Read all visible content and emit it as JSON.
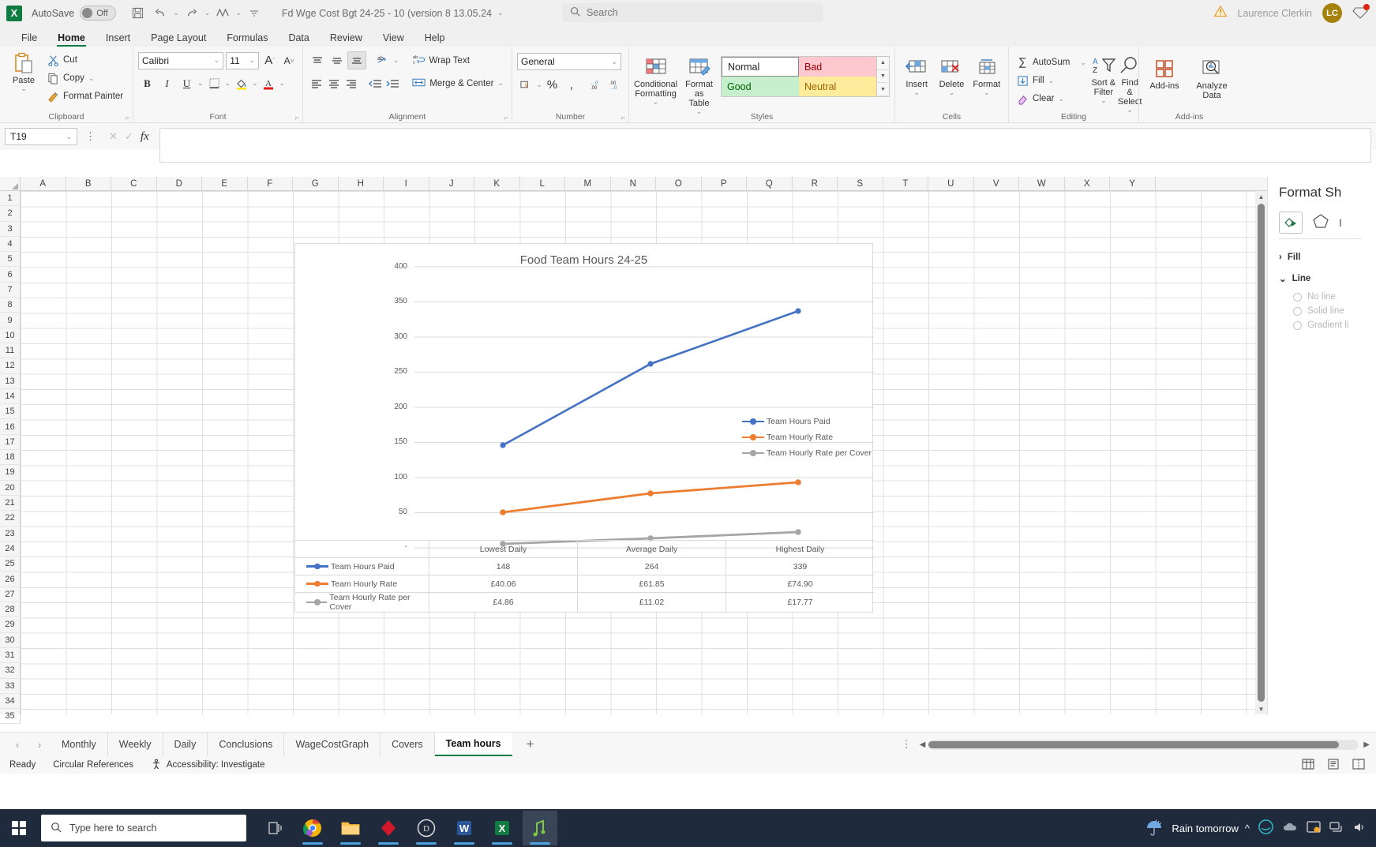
{
  "titlebar": {
    "autosave_label": "AutoSave",
    "autosave_state": "Off",
    "document_title": "Fd Wge Cost Bgt 24-25 - 10 (version 8 13.05.24",
    "search_placeholder": "Search",
    "user_name": "Laurence Clerkin",
    "user_initials": "LC"
  },
  "ribbon_tabs": [
    {
      "label": "File"
    },
    {
      "label": "Home"
    },
    {
      "label": "Insert"
    },
    {
      "label": "Page Layout"
    },
    {
      "label": "Formulas"
    },
    {
      "label": "Data"
    },
    {
      "label": "Review"
    },
    {
      "label": "View"
    },
    {
      "label": "Help"
    }
  ],
  "ribbon": {
    "clipboard": {
      "label": "Clipboard",
      "paste": "Paste",
      "cut": "Cut",
      "copy": "Copy",
      "format_painter": "Format Painter"
    },
    "font": {
      "label": "Font",
      "font_name": "Calibri",
      "font_size": "11",
      "grow": "A",
      "shrink": "A",
      "bold": "B",
      "italic": "I",
      "underline": "U"
    },
    "alignment": {
      "label": "Alignment",
      "wrap_text": "Wrap Text",
      "merge_center": "Merge & Center"
    },
    "number": {
      "label": "Number",
      "format": "General",
      "percent": "%",
      "comma": ","
    },
    "styles": {
      "label": "Styles",
      "conditional_formatting": "Conditional Formatting",
      "format_as_table": "Format as Table",
      "normal": "Normal",
      "bad": "Bad",
      "good": "Good",
      "neutral": "Neutral"
    },
    "cells": {
      "label": "Cells",
      "insert": "Insert",
      "delete": "Delete",
      "format": "Format"
    },
    "editing": {
      "label": "Editing",
      "autosum": "AutoSum",
      "fill": "Fill",
      "clear": "Clear",
      "sort_filter": "Sort & Filter",
      "find_select": "Find & Select"
    },
    "addins": {
      "label": "Add-ins",
      "addins_btn": "Add-ins",
      "analyze_data": "Analyze Data"
    }
  },
  "formula_bar": {
    "name_box": "T19",
    "value": ""
  },
  "grid": {
    "columns": [
      "A",
      "B",
      "C",
      "D",
      "E",
      "F",
      "G",
      "H",
      "I",
      "J",
      "K",
      "L",
      "M",
      "N",
      "O",
      "P",
      "Q",
      "R",
      "S",
      "T",
      "U",
      "V",
      "W",
      "X",
      "Y"
    ],
    "rows": [
      1,
      2,
      3,
      4,
      5,
      6,
      7,
      8,
      9,
      10,
      11,
      12,
      13,
      14,
      15,
      16,
      17,
      18,
      19,
      20,
      21,
      22,
      23,
      24,
      25,
      26,
      27,
      28,
      29,
      30,
      31,
      32,
      33,
      34,
      35
    ]
  },
  "chart_data": {
    "type": "line",
    "title": "Food Team Hours 24-25",
    "xlabel": "",
    "ylabel": "",
    "ylim": [
      0,
      400
    ],
    "yticks": [
      0,
      50,
      100,
      150,
      200,
      250,
      300,
      350,
      400
    ],
    "ytick_labels": [
      "-",
      "50",
      "100",
      "150",
      "200",
      "250",
      "300",
      "350",
      "400"
    ],
    "grid": true,
    "legend_position": "inside-right",
    "data_table_visible": true,
    "categories": [
      "Lowest Daily",
      "Average Daily",
      "Highest Daily"
    ],
    "series": [
      {
        "name": "Team Hours Paid",
        "color": "#4472c4",
        "values": [
          148,
          264,
          339
        ],
        "display_values": [
          "148",
          "264",
          "339"
        ]
      },
      {
        "name": "Team Hourly Rate",
        "color": "#ed7d31",
        "values": [
          40.06,
          61.85,
          74.9
        ],
        "display_values": [
          "£40.06",
          "£61.85",
          "£74.90"
        ]
      },
      {
        "name": "Team Hourly Rate per Cover",
        "color": "#a5a5a5",
        "values": [
          4.86,
          11.02,
          17.77
        ],
        "display_values": [
          "£4.86",
          "£11.02",
          "£17.77"
        ]
      }
    ]
  },
  "taskpane": {
    "title": "Format Sh",
    "fill_section": "Fill",
    "line_section": "Line",
    "options": [
      "No line",
      "Solid line",
      "Gradient li"
    ]
  },
  "sheet_tabs": [
    {
      "label": "Monthly",
      "active": false
    },
    {
      "label": "Weekly",
      "active": false
    },
    {
      "label": "Daily",
      "active": false
    },
    {
      "label": "Conclusions",
      "active": false
    },
    {
      "label": "WageCostGraph",
      "active": false
    },
    {
      "label": "Covers",
      "active": false
    },
    {
      "label": "Team hours",
      "active": true
    }
  ],
  "status_bar": {
    "ready": "Ready",
    "circular_references": "Circular References",
    "accessibility": "Accessibility: Investigate"
  },
  "taskbar": {
    "search_placeholder": "Type here to search",
    "weather": "Rain tomorrow"
  }
}
